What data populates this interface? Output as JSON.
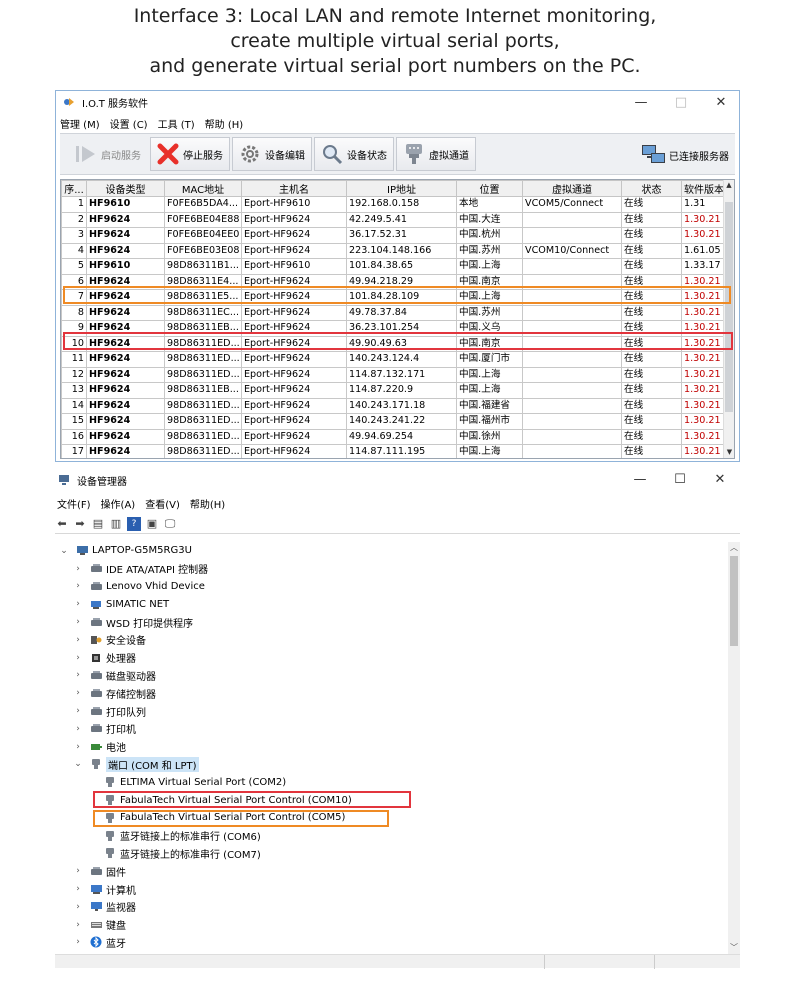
{
  "heading": [
    "Interface 3: Local LAN and remote Internet monitoring,",
    "create multiple virtual serial ports,",
    "and generate virtual serial port numbers on the PC."
  ],
  "iot": {
    "title": "I.O.T 服务软件",
    "controls": {
      "minimize": "—",
      "maximize": "□",
      "close": "✕"
    },
    "menu": [
      "管理 (M)",
      "设置 (C)",
      "工具 (T)",
      "帮助 (H)"
    ],
    "toolbar": [
      {
        "label": "启动服务",
        "icon": "play-icon",
        "enabled": false
      },
      {
        "label": "停止服务",
        "icon": "stop-x-icon",
        "enabled": true
      },
      {
        "label": "设备编辑",
        "icon": "gear-icon",
        "enabled": true
      },
      {
        "label": "设备状态",
        "icon": "magnifier-icon",
        "enabled": true
      },
      {
        "label": "虚拟通道",
        "icon": "serial-plug-icon",
        "enabled": true
      }
    ],
    "server_status": "已连接服务器",
    "columns": [
      "序...",
      "设备类型",
      "MAC地址",
      "主机名",
      "IP地址",
      "位置",
      "虚拟通道",
      "状态",
      "软件版本"
    ],
    "rows": [
      [
        "1",
        "HF9610",
        "F0FE6B5DA4...",
        "Eport-HF9610",
        "192.168.0.158",
        "本地",
        "VCOM5/Connect",
        "在线",
        "1.31"
      ],
      [
        "2",
        "HF9624",
        "F0FE6BE04E88",
        "Eport-HF9624",
        "42.249.5.41",
        "中国.大连",
        "",
        "在线",
        "1.30.21"
      ],
      [
        "3",
        "HF9624",
        "F0FE6BE04EE0",
        "Eport-HF9624",
        "36.17.52.31",
        "中国.杭州",
        "",
        "在线",
        "1.30.21"
      ],
      [
        "4",
        "HF9624",
        "F0FE6BE03E08",
        "Eport-HF9624",
        "223.104.148.166",
        "中国.苏州",
        "VCOM10/Connect",
        "在线",
        "1.61.05"
      ],
      [
        "5",
        "HF9610",
        "98D86311B1...",
        "Eport-HF9610",
        "101.84.38.65",
        "中国.上海",
        "",
        "在线",
        "1.33.17"
      ],
      [
        "6",
        "HF9624",
        "98D86311E4...",
        "Eport-HF9624",
        "49.94.218.29",
        "中国.南京",
        "",
        "在线",
        "1.30.21"
      ],
      [
        "7",
        "HF9624",
        "98D86311E5...",
        "Eport-HF9624",
        "101.84.28.109",
        "中国.上海",
        "",
        "在线",
        "1.30.21"
      ],
      [
        "8",
        "HF9624",
        "98D86311EC...",
        "Eport-HF9624",
        "49.78.37.84",
        "中国.苏州",
        "",
        "在线",
        "1.30.21"
      ],
      [
        "9",
        "HF9624",
        "98D86311EB...",
        "Eport-HF9624",
        "36.23.101.254",
        "中国.义乌",
        "",
        "在线",
        "1.30.21"
      ],
      [
        "10",
        "HF9624",
        "98D86311ED...",
        "Eport-HF9624",
        "49.90.49.63",
        "中国.南京",
        "",
        "在线",
        "1.30.21"
      ],
      [
        "11",
        "HF9624",
        "98D86311ED...",
        "Eport-HF9624",
        "140.243.124.4",
        "中国.厦门市",
        "",
        "在线",
        "1.30.21"
      ],
      [
        "12",
        "HF9624",
        "98D86311ED...",
        "Eport-HF9624",
        "114.87.132.171",
        "中国.上海",
        "",
        "在线",
        "1.30.21"
      ],
      [
        "13",
        "HF9624",
        "98D86311EB...",
        "Eport-HF9624",
        "114.87.220.9",
        "中国.上海",
        "",
        "在线",
        "1.30.21"
      ],
      [
        "14",
        "HF9624",
        "98D86311ED...",
        "Eport-HF9624",
        "140.243.171.18",
        "中国.福建省",
        "",
        "在线",
        "1.30.21"
      ],
      [
        "15",
        "HF9624",
        "98D86311ED...",
        "Eport-HF9624",
        "140.243.241.22",
        "中国.福州市",
        "",
        "在线",
        "1.30.21"
      ],
      [
        "16",
        "HF9624",
        "98D86311ED...",
        "Eport-HF9624",
        "49.94.69.254",
        "中国.徐州",
        "",
        "在线",
        "1.30.21"
      ],
      [
        "17",
        "HF9624",
        "98D86311ED...",
        "Eport-HF9624",
        "114.87.111.195",
        "中国.上海",
        "",
        "在线",
        "1.30.21"
      ]
    ]
  },
  "devmgr": {
    "title": "设备管理器",
    "controls": {
      "minimize": "—",
      "maximize": "☐",
      "close": "✕"
    },
    "menu": [
      "文件(F)",
      "操作(A)",
      "查看(V)",
      "帮助(H)"
    ],
    "root": "LAPTOP-G5M5RG3U",
    "tree": [
      {
        "label": "IDE ATA/ATAPI 控制器",
        "level": 1,
        "caret": "›",
        "icon": "ide-controller-icon"
      },
      {
        "label": "Lenovo Vhid Device",
        "level": 1,
        "caret": "›",
        "icon": "hid-device-icon"
      },
      {
        "label": "SIMATIC NET",
        "level": 1,
        "caret": "›",
        "icon": "network-icon"
      },
      {
        "label": "WSD 打印提供程序",
        "level": 1,
        "caret": "›",
        "icon": "printer-icon"
      },
      {
        "label": "安全设备",
        "level": 1,
        "caret": "›",
        "icon": "security-device-icon"
      },
      {
        "label": "处理器",
        "level": 1,
        "caret": "›",
        "icon": "processor-icon"
      },
      {
        "label": "磁盘驱动器",
        "level": 1,
        "caret": "›",
        "icon": "disk-drive-icon"
      },
      {
        "label": "存储控制器",
        "level": 1,
        "caret": "›",
        "icon": "storage-controller-icon"
      },
      {
        "label": "打印队列",
        "level": 1,
        "caret": "›",
        "icon": "print-queue-icon"
      },
      {
        "label": "打印机",
        "level": 1,
        "caret": "›",
        "icon": "printer-icon"
      },
      {
        "label": "电池",
        "level": 1,
        "caret": "›",
        "icon": "battery-icon"
      },
      {
        "label": "端口 (COM 和 LPT)",
        "level": 1,
        "caret": "⌄",
        "icon": "port-icon",
        "selected": true
      },
      {
        "label": "ELTIMA Virtual Serial Port (COM2)",
        "level": 2,
        "caret": "",
        "icon": "serial-port-icon"
      },
      {
        "label": "FabulaTech Virtual Serial Port Control (COM10)",
        "level": 2,
        "caret": "",
        "icon": "serial-port-icon"
      },
      {
        "label": "FabulaTech Virtual Serial Port Control (COM5)",
        "level": 2,
        "caret": "",
        "icon": "serial-port-icon"
      },
      {
        "label": "蓝牙链接上的标准串行 (COM6)",
        "level": 2,
        "caret": "",
        "icon": "serial-port-icon"
      },
      {
        "label": "蓝牙链接上的标准串行 (COM7)",
        "level": 2,
        "caret": "",
        "icon": "serial-port-icon"
      },
      {
        "label": "固件",
        "level": 1,
        "caret": "›",
        "icon": "firmware-icon"
      },
      {
        "label": "计算机",
        "level": 1,
        "caret": "›",
        "icon": "computer-icon"
      },
      {
        "label": "监视器",
        "level": 1,
        "caret": "›",
        "icon": "monitor-icon"
      },
      {
        "label": "键盘",
        "level": 1,
        "caret": "›",
        "icon": "keyboard-icon"
      },
      {
        "label": "蓝牙",
        "level": 1,
        "caret": "›",
        "icon": "bluetooth-icon"
      }
    ]
  },
  "colors": {
    "highlight_orange": "#ef8a24",
    "highlight_red": "#e2353d",
    "version_red": "#c00000",
    "selected_row": "#cce4f7"
  }
}
